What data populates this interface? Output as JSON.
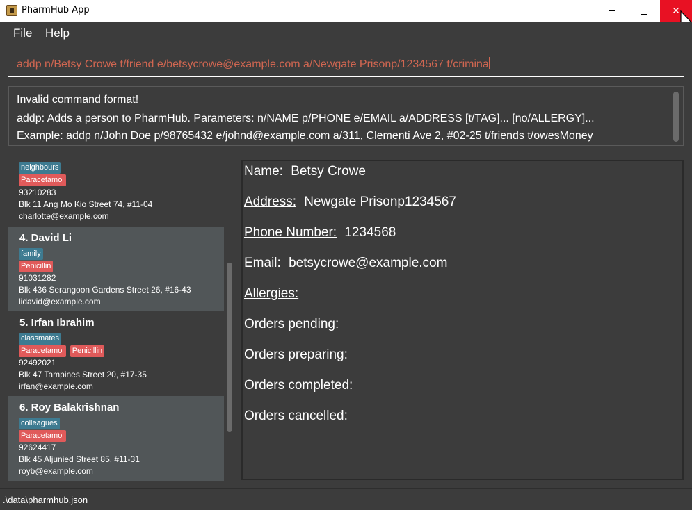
{
  "window": {
    "title": "PharmHub App",
    "controls": {
      "minimize": "minimize",
      "maximize": "maximize",
      "close": "✕"
    }
  },
  "menu": {
    "file": "File",
    "help": "Help"
  },
  "command": {
    "value": "addp n/Betsy Crowe t/friend e/betsycrowe@example.com a/Newgate Prisonp/1234567 t/crimina"
  },
  "result": {
    "lines": [
      "Invalid command format!",
      "addp: Adds a person to PharmHub. Parameters: n/NAME p/PHONE e/EMAIL a/ADDRESS [t/TAG]... [no/ALLERGY]...",
      "Example: addp n/John Doe p/98765432 e/johnd@example.com a/311, Clementi Ave 2, #02-25 t/friends t/owesMoney"
    ]
  },
  "persons": [
    {
      "name": "",
      "tags": [
        "neighbours"
      ],
      "allergies": [
        "Paracetamol"
      ],
      "phone": "93210283",
      "address": "Blk 11 Ang Mo Kio Street 74, #11-04",
      "email": "charlotte@example.com"
    },
    {
      "name": "4.  David Li",
      "tags": [
        "family"
      ],
      "allergies": [
        "Penicillin"
      ],
      "phone": "91031282",
      "address": "Blk 436 Serangoon Gardens Street 26, #16-43",
      "email": "lidavid@example.com"
    },
    {
      "name": "5.  Irfan Ibrahim",
      "tags": [
        "classmates"
      ],
      "allergies": [
        "Paracetamol",
        "Penicillin"
      ],
      "phone": "92492021",
      "address": "Blk 47 Tampines Street 20, #17-35",
      "email": "irfan@example.com"
    },
    {
      "name": "6.  Roy Balakrishnan",
      "tags": [
        "colleagues"
      ],
      "allergies": [
        "Paracetamol"
      ],
      "phone": "92624417",
      "address": "Blk 45 Aljunied Street 85, #11-31",
      "email": "royb@example.com"
    }
  ],
  "details": {
    "name_label": "Name:",
    "name_value": "Betsy Crowe",
    "address_label": "Address:",
    "address_value": "Newgate Prisonp1234567",
    "phone_label": "Phone Number:",
    "phone_value": "1234568",
    "email_label": "Email:",
    "email_value": "betsycrowe@example.com",
    "allergies_label": "Allergies:",
    "orders_pending": "Orders pending:",
    "orders_preparing": "Orders preparing:",
    "orders_completed": "Orders completed:",
    "orders_cancelled": "Orders cancelled:"
  },
  "status": {
    "path": ".\\data\\pharmhub.json"
  },
  "colors": {
    "background": "#3c3c3c",
    "selected_card": "#515658",
    "tag": "#3e7b91",
    "allergy": "#e05a5a",
    "command_text": "#d06651",
    "close_button": "#e81123"
  }
}
